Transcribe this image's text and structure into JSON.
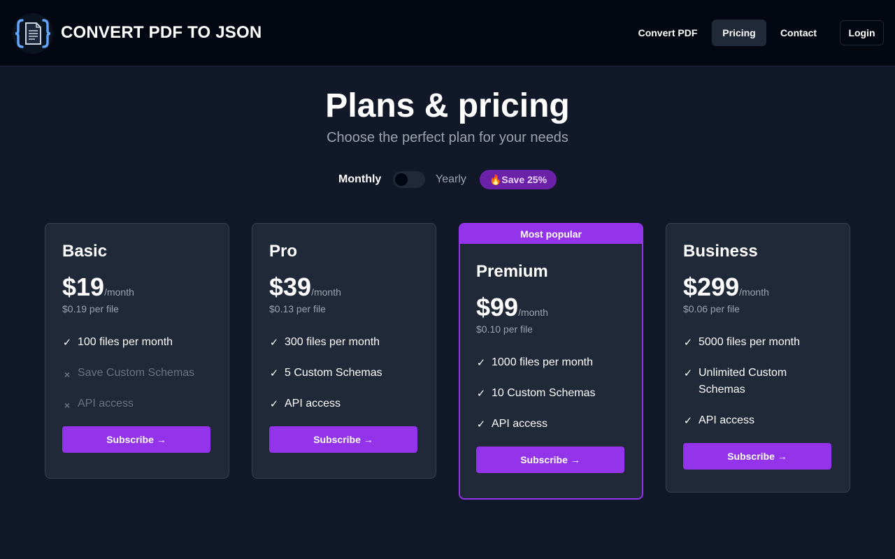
{
  "header": {
    "brand": "CONVERT PDF TO JSON",
    "logo_icon": "json-document-icon",
    "nav": {
      "convert_pdf": "Convert PDF",
      "pricing": "Pricing",
      "contact": "Contact",
      "login": "Login"
    }
  },
  "hero": {
    "title": "Plans & pricing",
    "subtitle": "Choose the perfect plan for your needs"
  },
  "billing_toggle": {
    "monthly_label": "Monthly",
    "yearly_label": "Yearly",
    "selected": "Monthly",
    "save_badge_icon": "🔥",
    "save_badge_text": "Save 25%"
  },
  "plans": [
    {
      "name": "Basic",
      "price": "$19",
      "period": "/month",
      "per_file": "$0.19 per file",
      "popular": false,
      "features": [
        {
          "text": "100 files per month",
          "included": true
        },
        {
          "text": "Save Custom Schemas",
          "included": false
        },
        {
          "text": "API access",
          "included": false
        }
      ],
      "cta": "Subscribe →"
    },
    {
      "name": "Pro",
      "price": "$39",
      "period": "/month",
      "per_file": "$0.13 per file",
      "popular": false,
      "features": [
        {
          "text": "300 files per month",
          "included": true
        },
        {
          "text": "5 Custom Schemas",
          "included": true
        },
        {
          "text": "API access",
          "included": true
        }
      ],
      "cta": "Subscribe →"
    },
    {
      "name": "Premium",
      "badge": "Most popular",
      "price": "$99",
      "period": "/month",
      "per_file": "$0.10 per file",
      "popular": true,
      "features": [
        {
          "text": "1000 files per month",
          "included": true
        },
        {
          "text": "10 Custom Schemas",
          "included": true
        },
        {
          "text": "API access",
          "included": true
        }
      ],
      "cta": "Subscribe →"
    },
    {
      "name": "Business",
      "price": "$299",
      "period": "/month",
      "per_file": "$0.06 per file",
      "popular": false,
      "features": [
        {
          "text": "5000 files per month",
          "included": true
        },
        {
          "text": "Unlimited Custom Schemas",
          "included": true
        },
        {
          "text": "API access",
          "included": true
        }
      ],
      "cta": "Subscribe →"
    }
  ],
  "icons": {
    "included": "✓",
    "excluded": "×"
  },
  "colors": {
    "accent": "#9333ea",
    "background": "#111827",
    "header_background": "#030712",
    "card_background": "#1f2937",
    "muted_text": "#9ca3af"
  }
}
